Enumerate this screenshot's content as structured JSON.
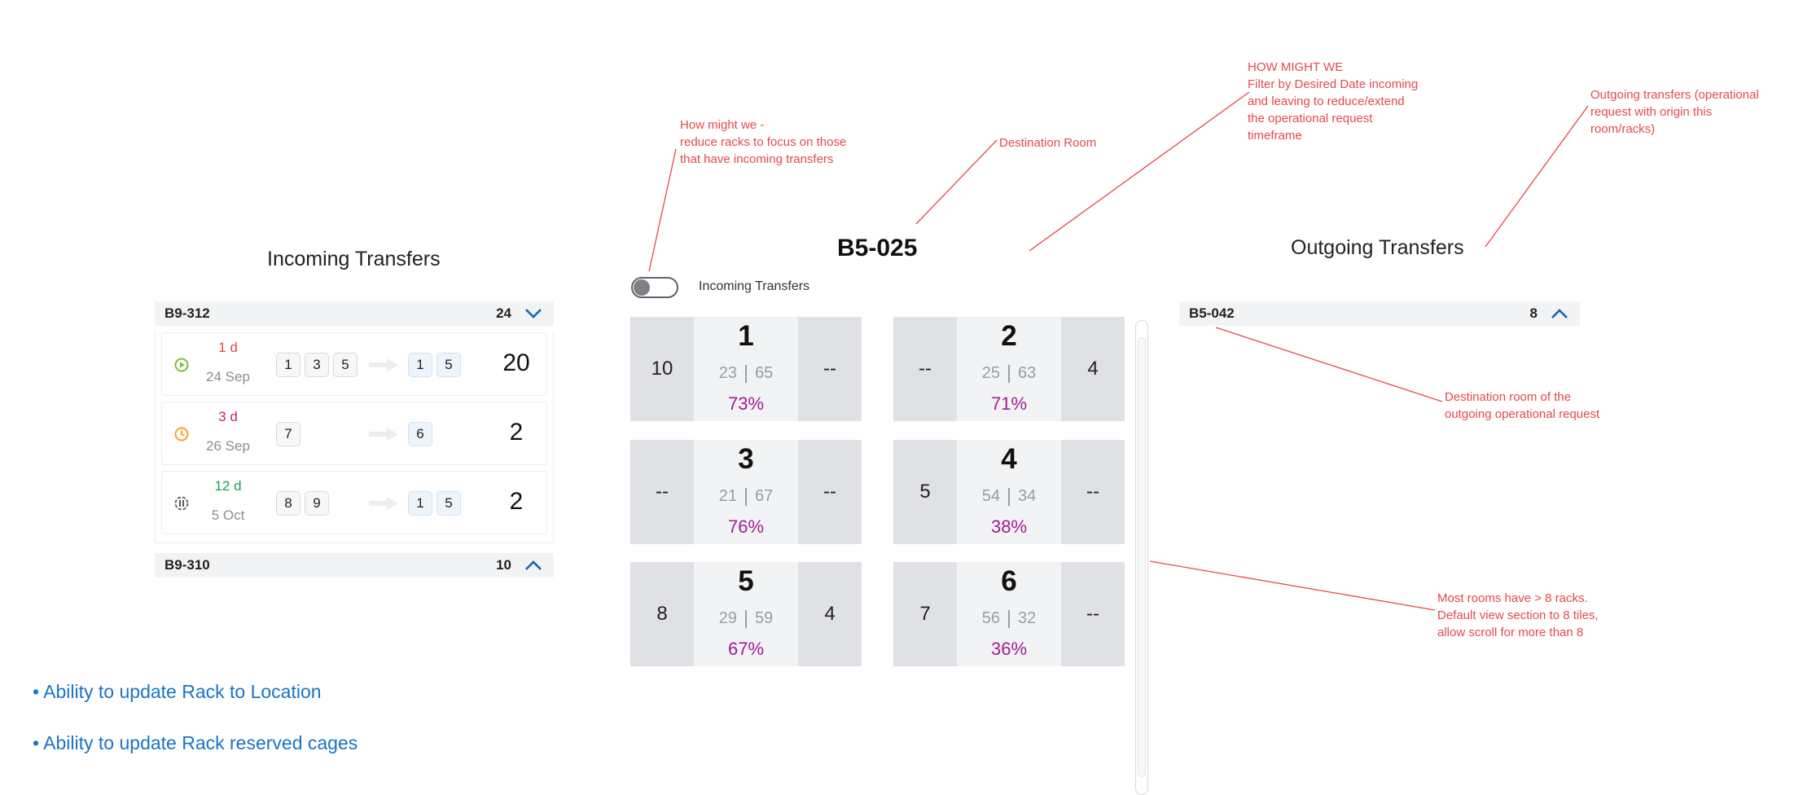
{
  "annotations": {
    "reduce_racks": [
      "How might we -",
      "reduce racks to focus on those",
      "that have incoming transfers"
    ],
    "destination_room": [
      "Destination Room"
    ],
    "filter_date": [
      "HOW MIGHT WE",
      "Filter by Desired Date incoming",
      "and leaving to reduce/extend",
      "the operational request",
      "timeframe"
    ],
    "outgoing_info": [
      "Outgoing transfers (operational",
      "request with origin this",
      "room/racks)"
    ],
    "outgoing_dest": [
      "Destination room of the",
      "outgoing operational request"
    ],
    "rooms_scroll": [
      "Most rooms have > 8 racks.",
      "Default view section to 8 tiles,",
      "allow scroll for more than 8"
    ]
  },
  "incoming": {
    "title": "Incoming Transfers",
    "groups": [
      {
        "name": "B9-312",
        "count": "24",
        "expanded": true,
        "chevron": "chevron-down-icon"
      },
      {
        "name": "B9-310",
        "count": "10",
        "expanded": false,
        "chevron": "chevron-up-icon"
      }
    ],
    "rows": [
      {
        "days": "1 d",
        "days_color": "#e5484d",
        "date": "24 Sep",
        "icon": "play-circle-icon",
        "icon_color": "#7ac13a",
        "from": [
          "1",
          "3",
          "5"
        ],
        "to": [
          "1",
          "5"
        ],
        "qty": "20"
      },
      {
        "days": "3 d",
        "days_color": "#c9284f",
        "date": "26 Sep",
        "icon": "clock-icon",
        "icon_color": "#f5a524",
        "from": [
          "7"
        ],
        "to": [
          "6"
        ],
        "qty": "2"
      },
      {
        "days": "12 d",
        "days_color": "#1f9d55",
        "date": "5 Oct",
        "icon": "pause-circle-icon",
        "icon_color": "#555b61",
        "from": [
          "8",
          "9"
        ],
        "to": [
          "1",
          "5"
        ],
        "qty": "2"
      }
    ]
  },
  "room": {
    "title": "B5-025",
    "toggle_label": "Incoming Transfers",
    "toggle_on": false,
    "racks": [
      {
        "number": "1",
        "left": "10",
        "right": "--",
        "used": "23",
        "total": "65",
        "pct": "73%"
      },
      {
        "number": "2",
        "left": "--",
        "right": "4",
        "used": "25",
        "total": "63",
        "pct": "71%"
      },
      {
        "number": "3",
        "left": "--",
        "right": "--",
        "used": "21",
        "total": "67",
        "pct": "76%"
      },
      {
        "number": "4",
        "left": "5",
        "right": "--",
        "used": "54",
        "total": "34",
        "pct": "38%"
      },
      {
        "number": "5",
        "left": "8",
        "right": "4",
        "used": "29",
        "total": "59",
        "pct": "67%"
      },
      {
        "number": "6",
        "left": "7",
        "right": "--",
        "used": "56",
        "total": "32",
        "pct": "36%"
      }
    ]
  },
  "outgoing": {
    "title": "Outgoing Transfers",
    "groups": [
      {
        "name": "B5-042",
        "count": "8",
        "expanded": false,
        "chevron": "chevron-up-icon"
      }
    ]
  },
  "features": [
    "• Ability to update Rack to Location",
    "• Ability to update Rack reserved cages"
  ],
  "colors": {
    "annotation": "#e5484d",
    "accent": "#1a73c8",
    "percent": "#a21c94",
    "chevron": "#1463b4"
  }
}
